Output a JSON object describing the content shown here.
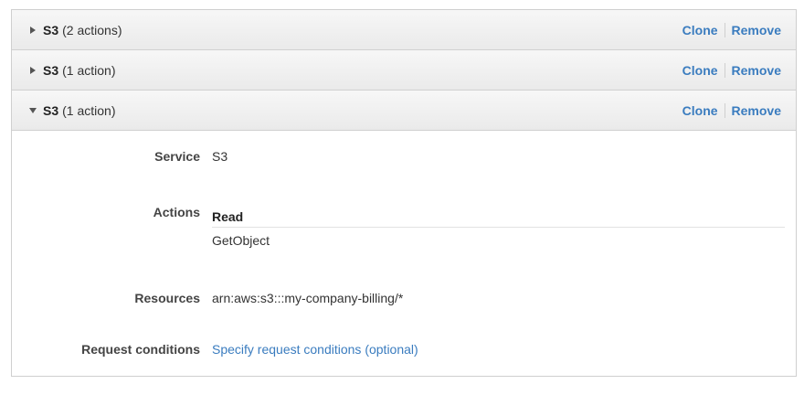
{
  "statements": [
    {
      "service": "S3",
      "action_count": "(2 actions)",
      "expanded": false,
      "icon": "caret-right-icon",
      "clone_label": "Clone",
      "remove_label": "Remove"
    },
    {
      "service": "S3",
      "action_count": "(1 action)",
      "expanded": false,
      "icon": "caret-right-icon",
      "clone_label": "Clone",
      "remove_label": "Remove"
    },
    {
      "service": "S3",
      "action_count": "(1 action)",
      "expanded": true,
      "icon": "caret-down-icon",
      "clone_label": "Clone",
      "remove_label": "Remove"
    }
  ],
  "details": {
    "service_label": "Service",
    "service_value": "S3",
    "actions_label": "Actions",
    "actions_heading": "Read",
    "actions_value": "GetObject",
    "resources_label": "Resources",
    "resources_value": "arn:aws:s3:::my-company-billing/*",
    "conditions_label": "Request conditions",
    "conditions_link": "Specify request conditions (optional)"
  },
  "colors": {
    "link": "#3a7cbf",
    "header_bg": "#eeeeee",
    "border": "#cfcfcf"
  }
}
